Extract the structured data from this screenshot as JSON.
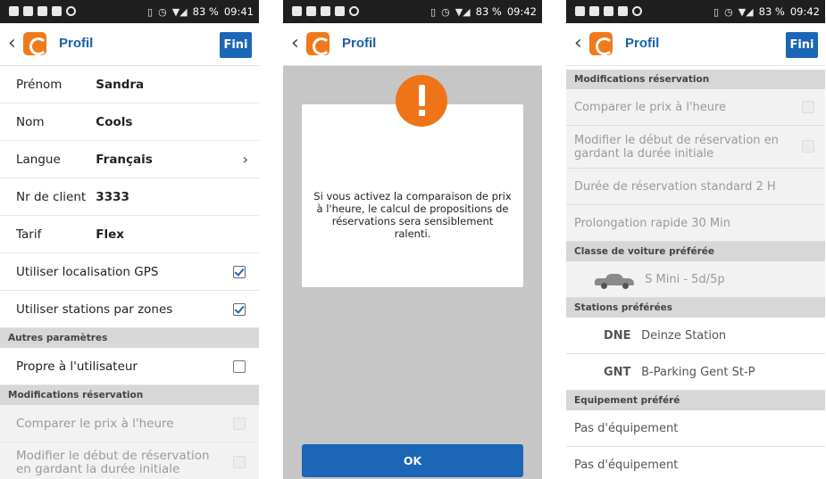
{
  "screens": [
    {
      "status": {
        "battery": "83 %",
        "time": "09:41"
      },
      "appbar": {
        "title": "Profil",
        "done_label": "Fini"
      },
      "fields": [
        {
          "label": "Prénom",
          "value": "Sandra"
        },
        {
          "label": "Nom",
          "value": "Cools"
        },
        {
          "label": "Langue",
          "value": "Français"
        },
        {
          "label": "Nr de client",
          "value": "3333"
        },
        {
          "label": "Tarif",
          "value": "Flex"
        }
      ],
      "toggles": [
        {
          "label": "Utiliser localisation GPS",
          "checked": true
        },
        {
          "label": "Utiliser stations par zones",
          "checked": true
        }
      ],
      "section_other": "Autres paramètres",
      "user_own": "Propre à l'utilisateur",
      "section_mods": "Modifications réservation",
      "compare": "Comparer le prix à l'heure",
      "modify_start": "Modifier le début de réservation en gardant la durée initiale"
    },
    {
      "status": {
        "battery": "83 %",
        "time": "09:42"
      },
      "appbar": {
        "title": "Profil"
      },
      "dialog_text": "Si vous activez la comparaison de prix à l'heure, le calcul de propositions de réservations sera sensiblement ralenti.",
      "ok_label": "OK"
    },
    {
      "status": {
        "battery": "83 %",
        "time": "09:42"
      },
      "appbar": {
        "title": "Profil",
        "done_label": "Fini"
      },
      "section_mods": "Modifications réservation",
      "compare": "Comparer le prix à l'heure",
      "modify_start": "Modifier le début de réservation en gardant la durée initiale",
      "standard_duration": "Durée de réservation standard 2 H",
      "quick_extension": "Prolongation rapide 30 Min",
      "section_car": "Classe de voiture préférée",
      "car_class": "S Mini - 5d/5p",
      "section_stations": "Stations préférées",
      "stations": [
        {
          "code": "DNE",
          "name": "Deinze Station"
        },
        {
          "code": "GNT",
          "name": "B-Parking Gent St-P"
        }
      ],
      "section_equipment": "Equipement préféré",
      "equipment": [
        "Pas d'équipement",
        "Pas d'équipement"
      ]
    }
  ]
}
